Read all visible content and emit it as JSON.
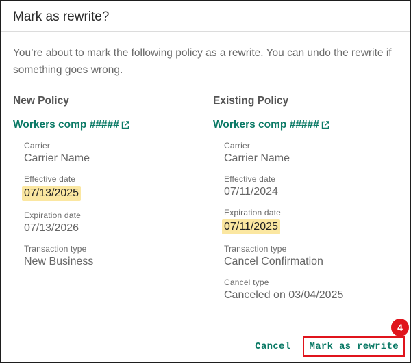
{
  "dialog": {
    "title": "Mark as rewrite?",
    "intro": "You’re about to mark the following policy as a rewrite. You can undo the rewrite if something goes wrong."
  },
  "new_policy": {
    "heading": "New Policy",
    "link_label": "Workers comp #####",
    "carrier_label": "Carrier",
    "carrier_value": "Carrier Name",
    "effective_label": "Effective date",
    "effective_value": "07/13/2025",
    "expiration_label": "Expiration date",
    "expiration_value": "07/13/2026",
    "transaction_label": "Transaction type",
    "transaction_value": "New Business"
  },
  "existing_policy": {
    "heading": "Existing Policy",
    "link_label": "Workers comp #####",
    "carrier_label": "Carrier",
    "carrier_value": "Carrier Name",
    "effective_label": "Effective date",
    "effective_value": "07/11/2024",
    "expiration_label": "Expiration date",
    "expiration_value": "07/11/2025",
    "transaction_label": "Transaction type",
    "transaction_value": "Cancel Confirmation",
    "cancel_type_label": "Cancel type",
    "cancel_type_value": "Canceled on 03/04/2025"
  },
  "actions": {
    "cancel_label": "Cancel",
    "confirm_label": "Mark as rewrite",
    "step_badge": "4"
  },
  "colors": {
    "accent": "#0b7a66",
    "highlight": "#fbe7a1",
    "annotation": "#e0141c"
  }
}
